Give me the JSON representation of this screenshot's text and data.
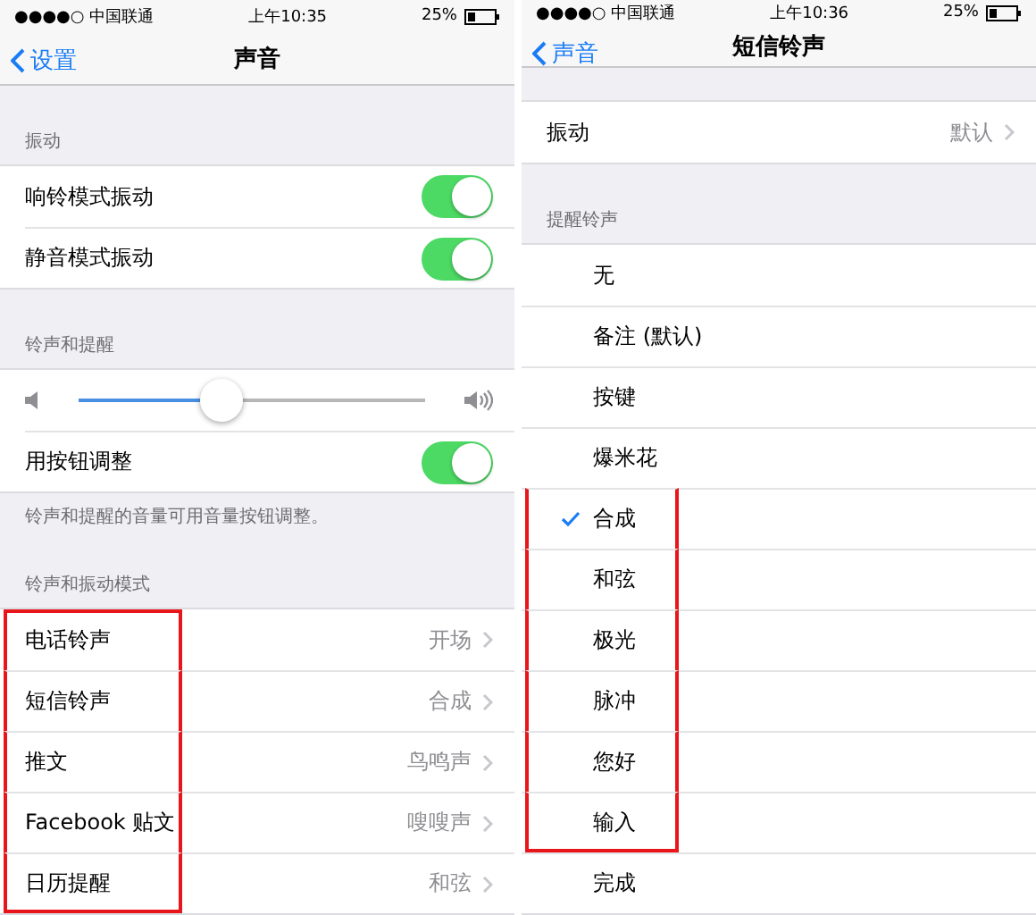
{
  "screens": [
    {
      "status": {
        "carrier": "●●●●○ 中国联通",
        "time": "上午10:35",
        "battery": "25%"
      },
      "nav": {
        "back": "设置",
        "title": "声音"
      },
      "sections": [
        {
          "header": "振动",
          "rows": [
            {
              "kind": "toggle",
              "label": "响铃模式振动",
              "on": true
            },
            {
              "kind": "toggle",
              "label": "静音模式振动",
              "on": true
            }
          ]
        },
        {
          "header": "铃声和提醒",
          "footer": "铃声和提醒的音量可用音量按钮调整。",
          "rows": [
            {
              "kind": "slider",
              "level": 0.41
            },
            {
              "kind": "toggle",
              "label": "用按钮调整",
              "on": true
            }
          ]
        },
        {
          "header": "铃声和振动模式",
          "rows": [
            {
              "kind": "link",
              "label": "电话铃声",
              "value": "开场",
              "highlighted": true
            },
            {
              "kind": "link",
              "label": "短信铃声",
              "value": "合成",
              "highlighted": true
            },
            {
              "kind": "link",
              "label": "推文",
              "value": "鸟鸣声",
              "highlighted": true
            },
            {
              "kind": "link",
              "label": "Facebook 贴文",
              "value": "嗖嗖声",
              "highlighted": true
            },
            {
              "kind": "link",
              "label": "日历提醒",
              "value": "和弦",
              "highlighted": true
            }
          ]
        }
      ]
    },
    {
      "status": {
        "carrier": "●●●●○ 中国联通",
        "time": "上午10:36",
        "battery": "25%"
      },
      "nav": {
        "back": "声音",
        "title": "短信铃声"
      },
      "sections": [
        {
          "rows": [
            {
              "kind": "link",
              "label": "振动",
              "value": "默认"
            }
          ]
        },
        {
          "header": "提醒铃声",
          "rows": [
            {
              "kind": "choice",
              "label": "无",
              "selected": false
            },
            {
              "kind": "choice",
              "label": "备注 (默认)",
              "selected": false
            },
            {
              "kind": "choice",
              "label": "按键",
              "selected": false
            },
            {
              "kind": "choice",
              "label": "爆米花",
              "selected": false
            },
            {
              "kind": "choice",
              "label": "合成",
              "selected": true,
              "highlighted": true
            },
            {
              "kind": "choice",
              "label": "和弦",
              "selected": false,
              "highlighted": true
            },
            {
              "kind": "choice",
              "label": "极光",
              "selected": false,
              "highlighted": true
            },
            {
              "kind": "choice",
              "label": "脉冲",
              "selected": false,
              "highlighted": true
            },
            {
              "kind": "choice",
              "label": "您好",
              "selected": false,
              "highlighted": true
            },
            {
              "kind": "choice",
              "label": "输入",
              "selected": false,
              "highlighted": true
            },
            {
              "kind": "choice",
              "label": "完成",
              "selected": false
            }
          ]
        }
      ]
    }
  ]
}
